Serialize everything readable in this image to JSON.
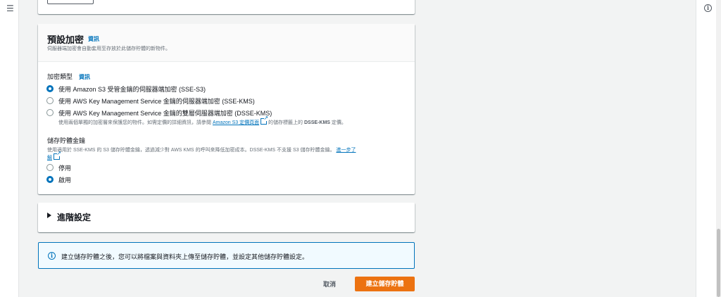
{
  "icons": {
    "menu": "hamburger-icon",
    "info": "info-icon",
    "external": "external-link-icon",
    "expand": "caret-right-icon"
  },
  "colors": {
    "link": "#0073bb",
    "primary_button": "#ec7211",
    "alert_bg": "#f1faff"
  },
  "encryption": {
    "title": "預設加密",
    "info": "資訊",
    "description": "伺服器端加密會自動套用至存放於此儲存貯體的新物件。",
    "type_label": "加密類型",
    "type_info": "資訊",
    "options": [
      {
        "label": "使用 Amazon S3 受管金鑰的伺服器端加密 (SSE-S3)",
        "selected": true
      },
      {
        "label": "使用 AWS Key Management Service 金鑰的伺服器端加密 (SSE-KMS)",
        "selected": false
      },
      {
        "label": "使用 AWS Key Management Service 金鑰的雙層伺服器端加密 (DSSE-KMS)",
        "selected": false
      }
    ],
    "dsse_note_prefix": "使用兩個單獨的加密層來保護您的物件。如需定價的詳細資訊，請參閱",
    "dsse_note_link": "Amazon S3 定價頁面",
    "dsse_note_mid": "的儲存標籤上的",
    "dsse_note_strong": "DSSE-KMS",
    "dsse_note_suffix": "定價。",
    "bucket_key_label": "儲存貯體金鑰",
    "bucket_key_desc": "使用適用於 SSE-KMS 的 S3 儲存貯體金鑰，透過減少對 AWS KMS 的呼叫來降低加密成本。DSSE-KMS 不支援 S3 儲存貯體金鑰。",
    "bucket_key_link_a": "進一步了",
    "bucket_key_link_b": "解",
    "bucket_key_options": [
      {
        "label": "停用",
        "selected": false
      },
      {
        "label": "啟用",
        "selected": true
      }
    ]
  },
  "advanced": {
    "label": "進階設定"
  },
  "alert": {
    "text": "建立儲存貯體之後，您可以將檔案與資料夾上傳至儲存貯體，並設定其他儲存貯體設定。"
  },
  "actions": {
    "cancel": "取消",
    "create": "建立儲存貯體"
  }
}
